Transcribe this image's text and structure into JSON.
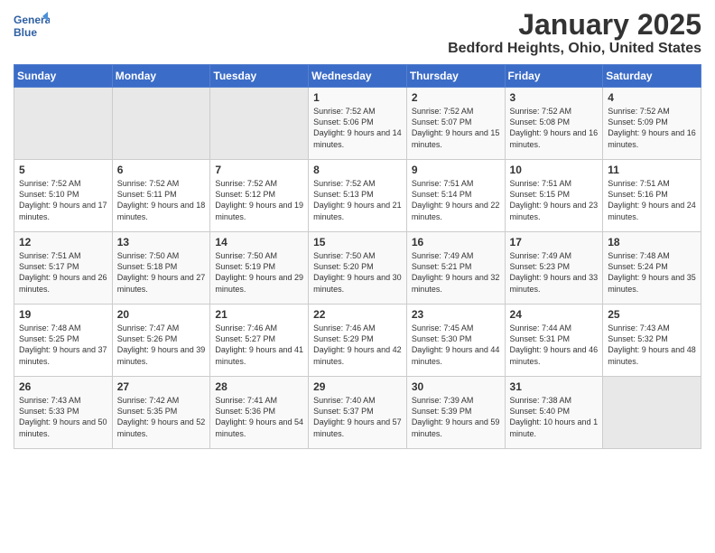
{
  "app": {
    "logo_text_top": "General",
    "logo_text_bottom": "Blue"
  },
  "header": {
    "month": "January 2025",
    "location": "Bedford Heights, Ohio, United States"
  },
  "weekdays": [
    "Sunday",
    "Monday",
    "Tuesday",
    "Wednesday",
    "Thursday",
    "Friday",
    "Saturday"
  ],
  "weeks": [
    [
      {
        "day": "",
        "empty": true
      },
      {
        "day": "",
        "empty": true
      },
      {
        "day": "",
        "empty": true
      },
      {
        "day": "1",
        "sunrise": "7:52 AM",
        "sunset": "5:06 PM",
        "daylight": "9 hours and 14 minutes."
      },
      {
        "day": "2",
        "sunrise": "7:52 AM",
        "sunset": "5:07 PM",
        "daylight": "9 hours and 15 minutes."
      },
      {
        "day": "3",
        "sunrise": "7:52 AM",
        "sunset": "5:08 PM",
        "daylight": "9 hours and 16 minutes."
      },
      {
        "day": "4",
        "sunrise": "7:52 AM",
        "sunset": "5:09 PM",
        "daylight": "9 hours and 16 minutes."
      }
    ],
    [
      {
        "day": "5",
        "sunrise": "7:52 AM",
        "sunset": "5:10 PM",
        "daylight": "9 hours and 17 minutes."
      },
      {
        "day": "6",
        "sunrise": "7:52 AM",
        "sunset": "5:11 PM",
        "daylight": "9 hours and 18 minutes."
      },
      {
        "day": "7",
        "sunrise": "7:52 AM",
        "sunset": "5:12 PM",
        "daylight": "9 hours and 19 minutes."
      },
      {
        "day": "8",
        "sunrise": "7:52 AM",
        "sunset": "5:13 PM",
        "daylight": "9 hours and 21 minutes."
      },
      {
        "day": "9",
        "sunrise": "7:51 AM",
        "sunset": "5:14 PM",
        "daylight": "9 hours and 22 minutes."
      },
      {
        "day": "10",
        "sunrise": "7:51 AM",
        "sunset": "5:15 PM",
        "daylight": "9 hours and 23 minutes."
      },
      {
        "day": "11",
        "sunrise": "7:51 AM",
        "sunset": "5:16 PM",
        "daylight": "9 hours and 24 minutes."
      }
    ],
    [
      {
        "day": "12",
        "sunrise": "7:51 AM",
        "sunset": "5:17 PM",
        "daylight": "9 hours and 26 minutes."
      },
      {
        "day": "13",
        "sunrise": "7:50 AM",
        "sunset": "5:18 PM",
        "daylight": "9 hours and 27 minutes."
      },
      {
        "day": "14",
        "sunrise": "7:50 AM",
        "sunset": "5:19 PM",
        "daylight": "9 hours and 29 minutes."
      },
      {
        "day": "15",
        "sunrise": "7:50 AM",
        "sunset": "5:20 PM",
        "daylight": "9 hours and 30 minutes."
      },
      {
        "day": "16",
        "sunrise": "7:49 AM",
        "sunset": "5:21 PM",
        "daylight": "9 hours and 32 minutes."
      },
      {
        "day": "17",
        "sunrise": "7:49 AM",
        "sunset": "5:23 PM",
        "daylight": "9 hours and 33 minutes."
      },
      {
        "day": "18",
        "sunrise": "7:48 AM",
        "sunset": "5:24 PM",
        "daylight": "9 hours and 35 minutes."
      }
    ],
    [
      {
        "day": "19",
        "sunrise": "7:48 AM",
        "sunset": "5:25 PM",
        "daylight": "9 hours and 37 minutes."
      },
      {
        "day": "20",
        "sunrise": "7:47 AM",
        "sunset": "5:26 PM",
        "daylight": "9 hours and 39 minutes."
      },
      {
        "day": "21",
        "sunrise": "7:46 AM",
        "sunset": "5:27 PM",
        "daylight": "9 hours and 41 minutes."
      },
      {
        "day": "22",
        "sunrise": "7:46 AM",
        "sunset": "5:29 PM",
        "daylight": "9 hours and 42 minutes."
      },
      {
        "day": "23",
        "sunrise": "7:45 AM",
        "sunset": "5:30 PM",
        "daylight": "9 hours and 44 minutes."
      },
      {
        "day": "24",
        "sunrise": "7:44 AM",
        "sunset": "5:31 PM",
        "daylight": "9 hours and 46 minutes."
      },
      {
        "day": "25",
        "sunrise": "7:43 AM",
        "sunset": "5:32 PM",
        "daylight": "9 hours and 48 minutes."
      }
    ],
    [
      {
        "day": "26",
        "sunrise": "7:43 AM",
        "sunset": "5:33 PM",
        "daylight": "9 hours and 50 minutes."
      },
      {
        "day": "27",
        "sunrise": "7:42 AM",
        "sunset": "5:35 PM",
        "daylight": "9 hours and 52 minutes."
      },
      {
        "day": "28",
        "sunrise": "7:41 AM",
        "sunset": "5:36 PM",
        "daylight": "9 hours and 54 minutes."
      },
      {
        "day": "29",
        "sunrise": "7:40 AM",
        "sunset": "5:37 PM",
        "daylight": "9 hours and 57 minutes."
      },
      {
        "day": "30",
        "sunrise": "7:39 AM",
        "sunset": "5:39 PM",
        "daylight": "9 hours and 59 minutes."
      },
      {
        "day": "31",
        "sunrise": "7:38 AM",
        "sunset": "5:40 PM",
        "daylight": "10 hours and 1 minute."
      },
      {
        "day": "",
        "empty": true
      }
    ]
  ]
}
